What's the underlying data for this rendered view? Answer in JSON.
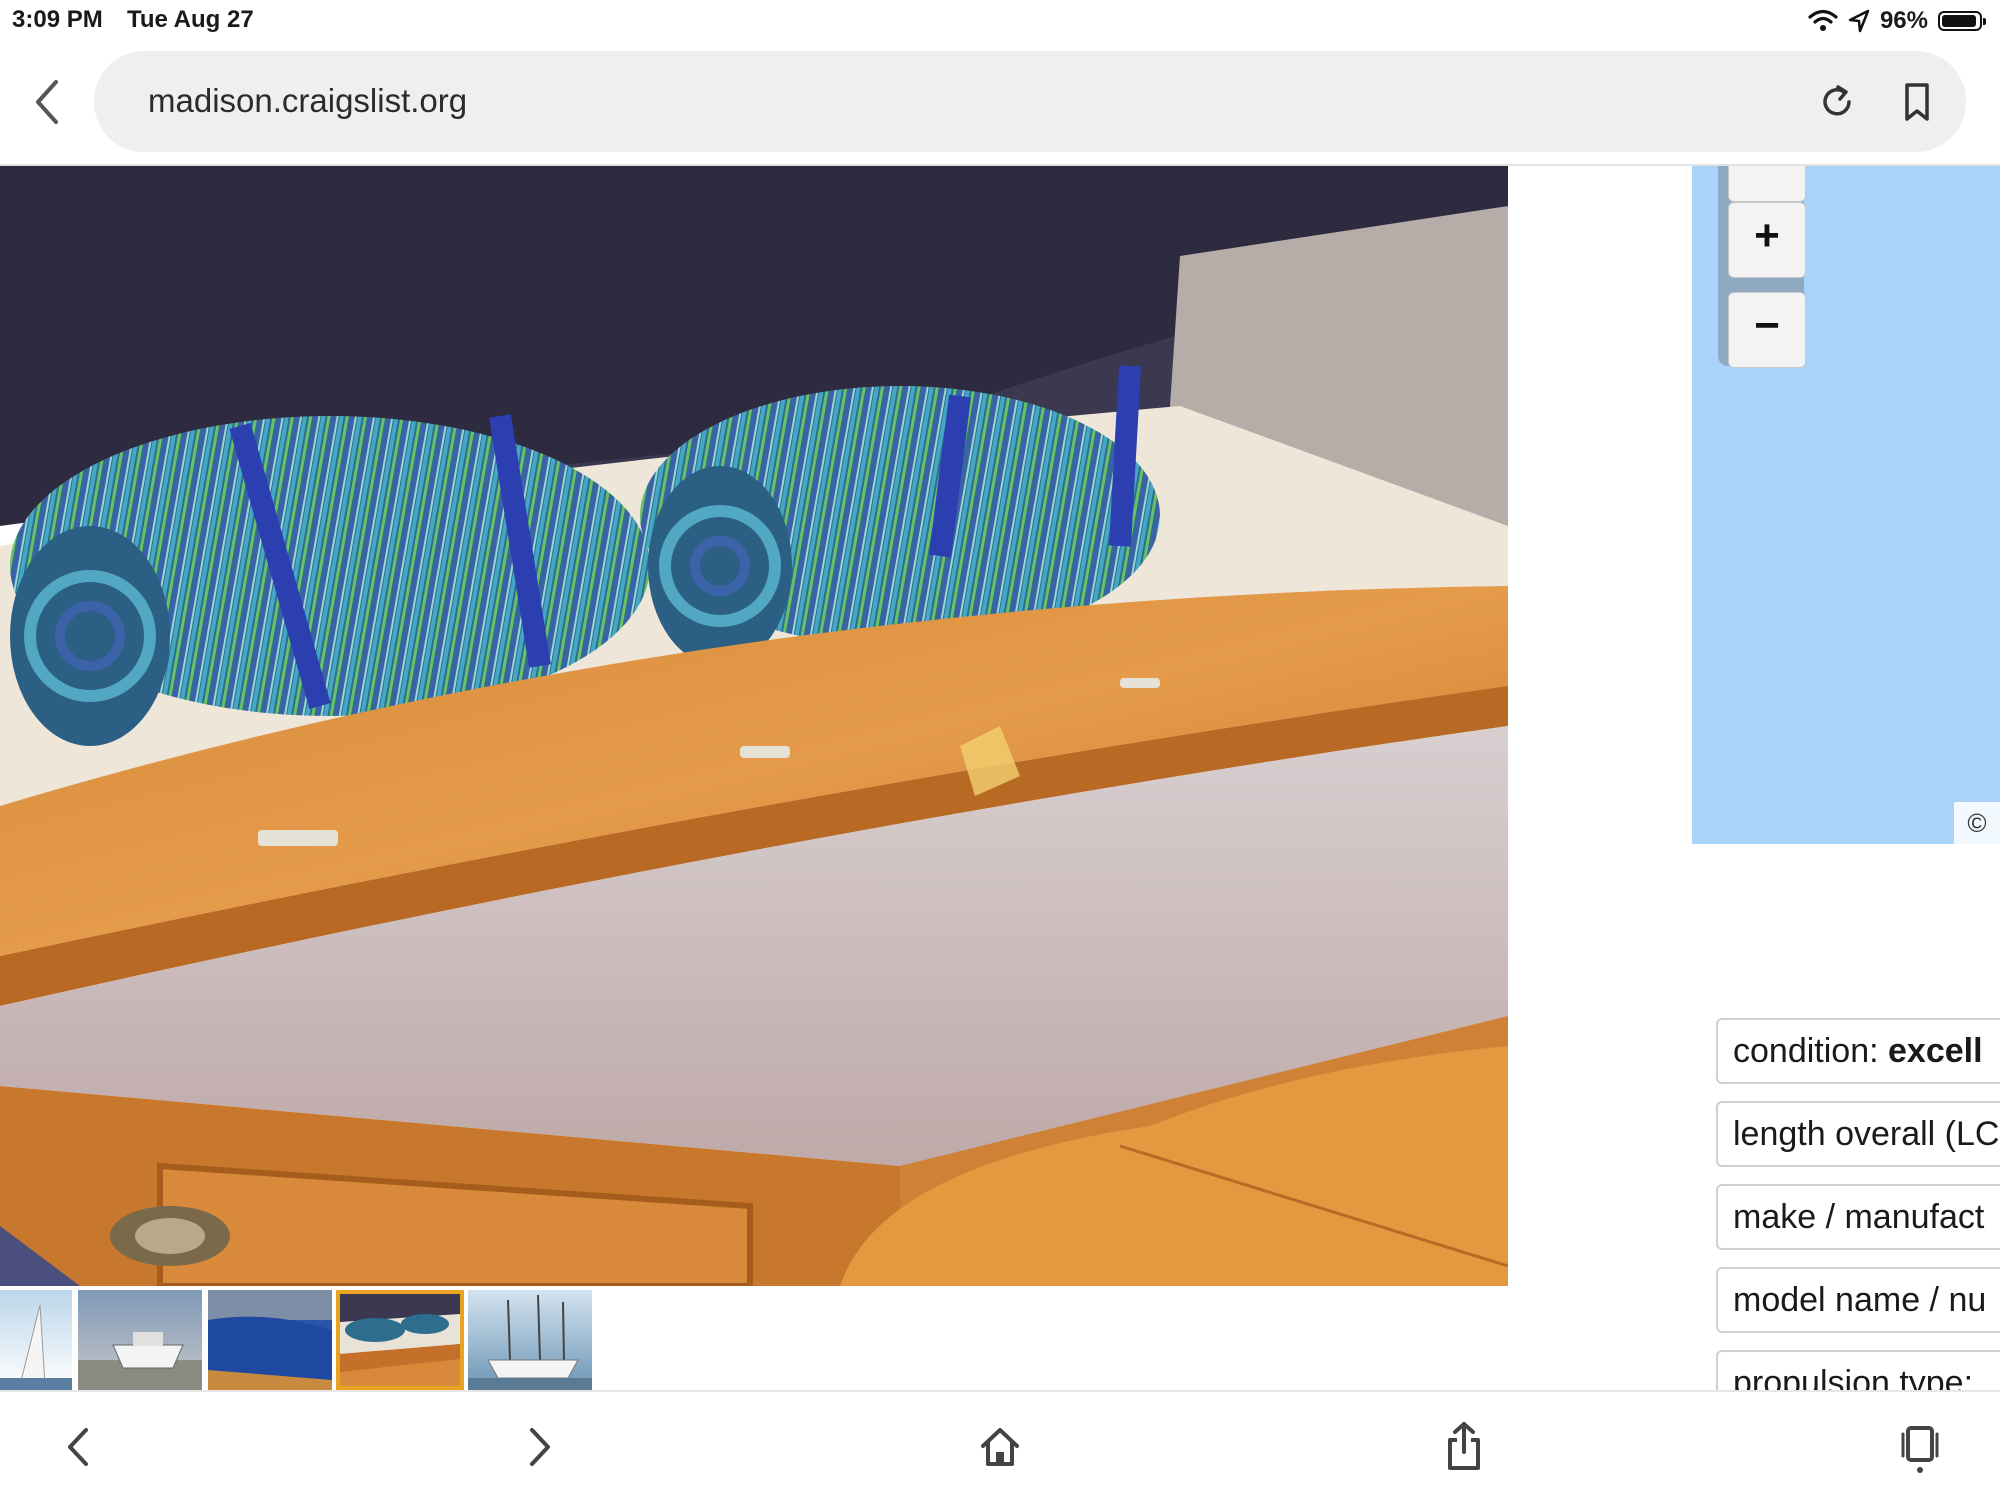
{
  "status_bar": {
    "time": "3:09 PM",
    "date": "Tue Aug 27",
    "battery": "96%"
  },
  "browser": {
    "url": "madison.craigslist.org"
  },
  "map": {
    "zoom_in": "+",
    "zoom_out": "−",
    "attribution": "©",
    "water_color": "#aad3f9"
  },
  "attributes": [
    {
      "label": "condition: ",
      "value": "excell"
    },
    {
      "label": "length overall (LC",
      "value": ""
    },
    {
      "label": "make / manufact",
      "value": ""
    },
    {
      "label": "model name / nu",
      "value": ""
    },
    {
      "label": "propulsion type: ",
      "value": ""
    }
  ],
  "thumbnails": {
    "selected_index": 3,
    "selected_color": "#e8a323"
  }
}
